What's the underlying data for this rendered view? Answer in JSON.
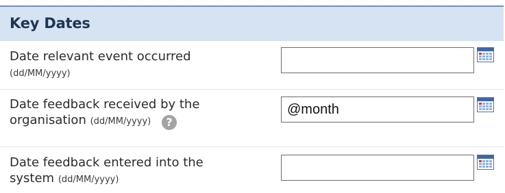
{
  "section": {
    "title": "Key Dates"
  },
  "fields": [
    {
      "label": "Date relevant event occurred",
      "format": "(dd/MM/yyyy)",
      "value": "",
      "icon": "calendar-icon"
    },
    {
      "label_line1": "Date feedback received by the",
      "label_line2": "organisation",
      "format": "(dd/MM/yyyy)",
      "value": "@month",
      "help_icon": "?",
      "icon": "calendar-icon"
    },
    {
      "label_line1": "Date feedback entered into the",
      "label_line2": "system",
      "format": "(dd/MM/yyyy)",
      "value": "",
      "icon": "calendar-icon"
    }
  ],
  "colors": {
    "header_bg": "#d6e3f2",
    "header_border": "#6f8fb5",
    "header_text": "#1f3552"
  }
}
